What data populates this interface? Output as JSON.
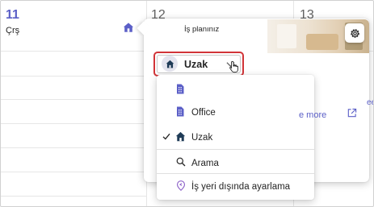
{
  "calendar": {
    "days": [
      {
        "number": "11",
        "name": "Çrş"
      },
      {
        "number": "12"
      },
      {
        "number": "13"
      }
    ]
  },
  "popup": {
    "title": "İş planınız",
    "selected_status": "Uzak",
    "see_more": "e more",
    "edge_text": "ee"
  },
  "dropdown": {
    "items": [
      {
        "label": "",
        "icon": "building-icon",
        "checked": false
      },
      {
        "label": "Office",
        "icon": "building-icon",
        "checked": false
      },
      {
        "label": "Uzak",
        "icon": "home-icon",
        "checked": true
      }
    ],
    "search_label": "Arama",
    "offsite_label": "İş yeri dışında ayarlama"
  },
  "colors": {
    "accent": "#5b5fc7",
    "highlight_border": "#d13438",
    "icon_navy": "#1f3b57",
    "icon_purple": "#8b5fc7"
  }
}
